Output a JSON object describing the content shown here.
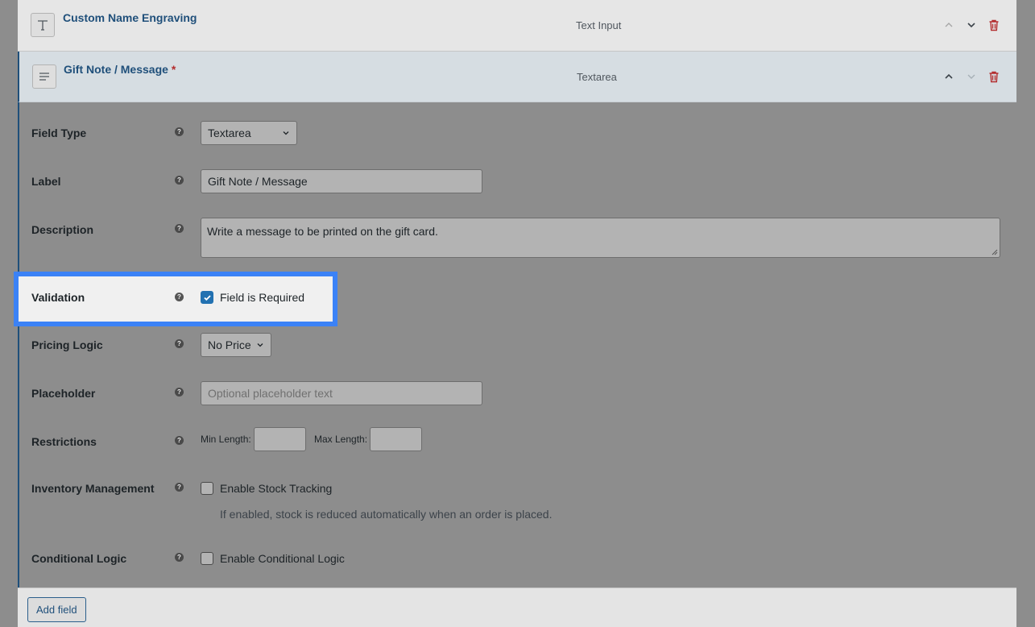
{
  "fields": [
    {
      "title": "Custom Name Engraving",
      "required": false,
      "type_label": "Text Input",
      "icon": "text-t-icon"
    },
    {
      "title": "Gift Note / Message",
      "required": true,
      "required_marker": "*",
      "type_label": "Textarea",
      "icon": "paragraph-lines-icon"
    }
  ],
  "form": {
    "field_type": {
      "label": "Field Type",
      "value": "Textarea"
    },
    "label": {
      "label": "Label",
      "value": "Gift Note / Message"
    },
    "description": {
      "label": "Description",
      "value": "Write a message to be printed on the gift card."
    },
    "validation": {
      "label": "Validation",
      "checkbox_label": "Field is Required",
      "checked": true
    },
    "pricing_logic": {
      "label": "Pricing Logic",
      "value": "No Price"
    },
    "placeholder": {
      "label": "Placeholder",
      "placeholder": "Optional placeholder text"
    },
    "restrictions": {
      "label": "Restrictions",
      "min_label": "Min Length:",
      "max_label": "Max Length:"
    },
    "inventory": {
      "label": "Inventory Management",
      "checkbox_label": "Enable Stock Tracking",
      "hint": "If enabled, stock is reduced automatically when an order is placed.",
      "checked": false
    },
    "conditional": {
      "label": "Conditional Logic",
      "checkbox_label": "Enable Conditional Logic",
      "checked": false
    }
  },
  "help_glyph": "?",
  "footer": {
    "add_field_label": "Add field"
  },
  "colors": {
    "accent": "#2271b1",
    "highlight": "#3b82f6",
    "delete": "#b32d2e",
    "title": "#1f4f7a"
  }
}
